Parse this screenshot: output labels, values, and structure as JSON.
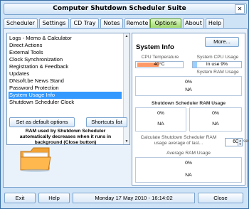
{
  "window": {
    "title": "Computer Shutdown Scheduler Suite",
    "close_glyph": "✕"
  },
  "tabs": [
    {
      "label": "Scheduler",
      "active": false
    },
    {
      "label": "Settings",
      "active": false
    },
    {
      "label": "CD Tray",
      "active": false
    },
    {
      "label": "Notes",
      "active": false
    },
    {
      "label": "Remote",
      "active": false
    },
    {
      "label": "Options",
      "active": true
    },
    {
      "label": "About",
      "active": false
    },
    {
      "label": "Help",
      "active": false
    }
  ],
  "list": {
    "items": [
      {
        "label": "Logs - Memo & Calculator",
        "selected": false
      },
      {
        "label": "Direct Actions",
        "selected": false
      },
      {
        "label": "External Tools",
        "selected": false
      },
      {
        "label": "Clock Synchronization",
        "selected": false
      },
      {
        "label": "Registration & Feedback",
        "selected": false
      },
      {
        "label": "Updates",
        "selected": false
      },
      {
        "label": "DNsoft.be News Stand",
        "selected": false
      },
      {
        "label": "Password Protection",
        "selected": false
      },
      {
        "label": "System Usage Info",
        "selected": true
      },
      {
        "label": "Shutdown Scheduler Clock",
        "selected": false
      }
    ]
  },
  "buttons": {
    "set_default": "Set as default options",
    "shortcuts": "Shortcuts list",
    "more": "More..."
  },
  "info_text": "RAM used by Shutdown Scheduler automatically decreases when it runs in background (Close button)",
  "system_info": {
    "title": "System Info",
    "cpu_temp_label": "CPU Temperature",
    "cpu_temp_value": "40°C",
    "cpu_usage_label": "System CPU Usage",
    "cpu_usage_value": "In use 9%",
    "cpu_usage_fraction": 0.09,
    "ram_label": "System RAM Usage",
    "ram_percent": "0%",
    "ram_value": "NA",
    "sched_ram_label": "Shutdown Scheduler RAM Usage",
    "sched_ram_left_percent": "0%",
    "sched_ram_left_value": "NA",
    "sched_ram_right_percent": "0%",
    "sched_ram_right_value": "NA",
    "calc_label": "Calculate Shutdown Scheduler RAM usage average of last...",
    "calc_value": "60",
    "calc_unit": "sec",
    "avg_label": "Average RAM Usage",
    "avg_percent": "0%",
    "avg_value": "NA"
  },
  "footer": {
    "exit": "Exit",
    "help": "Help",
    "datetime": "Monday 17 May 2010 - 16:14:02",
    "close": "Close"
  },
  "colors": {
    "accent": "#3399ff",
    "active_tab": "#9fd86d",
    "border": "#7aa3cf"
  }
}
